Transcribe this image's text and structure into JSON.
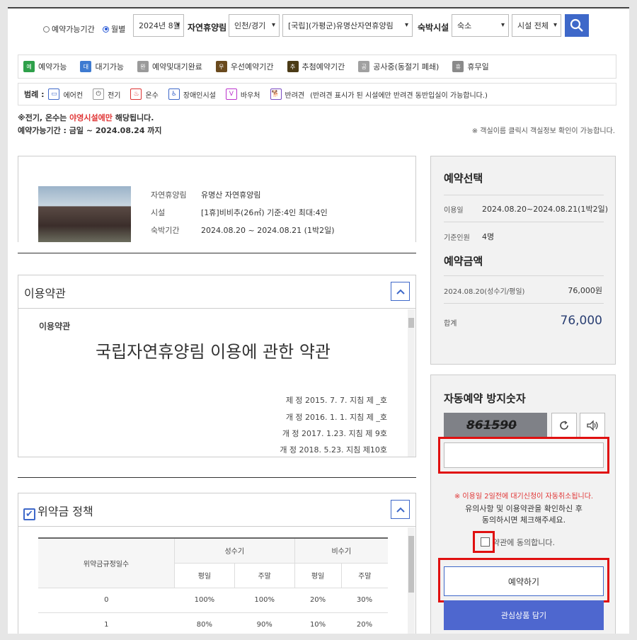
{
  "search": {
    "radio_period": "예약가능기간",
    "radio_month": "월별",
    "month": "2024년 8월",
    "label_forest": "자연휴양림",
    "region": "인천/경기",
    "forest": "[국립](가평군)유명산자연휴양림",
    "label_facility": "숙박시설",
    "facility_type": "숙소",
    "facility_all": "시설 전체"
  },
  "status_legend": [
    {
      "badge": "예",
      "label": "예약가능",
      "color": "#2ea04a"
    },
    {
      "badge": "대",
      "label": "대기가능",
      "color": "#3e7bd1"
    },
    {
      "badge": "완",
      "label": "예약및대기완료",
      "color": "#9a9a9a"
    },
    {
      "badge": "우",
      "label": "우선예약기간",
      "color": "#6a4a1e"
    },
    {
      "badge": "추",
      "label": "추첨예약기간",
      "color": "#4b3b16"
    },
    {
      "badge": "공",
      "label": "공사중(동절기 폐쇄)",
      "color": "#a0a0a0"
    },
    {
      "badge": "휴",
      "label": "휴무일",
      "color": "#8a8a8a"
    }
  ],
  "amenity_legend": {
    "title": "범례 :",
    "items": [
      {
        "label": "에어컨",
        "icon": "aircon-icon"
      },
      {
        "label": "전기",
        "icon": "electric-icon"
      },
      {
        "label": "온수",
        "icon": "hotwater-icon"
      },
      {
        "label": "장애인시설",
        "icon": "accessible-icon"
      },
      {
        "label": "바우처",
        "icon": "voucher-icon"
      },
      {
        "label": "반려견",
        "icon": "pet-icon"
      }
    ],
    "pet_note": "(반려견 표시가 된 시설에만 반려견 동반입실이 가능합니다.)"
  },
  "notes": {
    "line1_a": "※전기, 온수는 ",
    "line1_b": "야영시설에만",
    "line1_c": " 해당됩니다.",
    "line2": "예약가능기간 : 금일 ~ 2024.08.24 까지",
    "line3": "※ 객실이름 클릭시 객실정보 확인이 가능합니다."
  },
  "info": {
    "k_forest": "자연휴양림",
    "v_forest": "유명산 자연휴양림",
    "k_facility": "시설",
    "v_facility": "[1휴]비비추(26㎡) 기준:4인 최대:4인",
    "k_period": "숙박기간",
    "v_period": "2024.08.20 ~ 2024.08.21 (1박2일)"
  },
  "terms": {
    "panel_title": "이용약관",
    "small": "이용약관",
    "big": "국립자연휴양림 이용에 관한 약관",
    "lines": [
      "제 정 2015. 7. 7. 지침 제 _호",
      "개 정 2016. 1. 1. 지침 제 _호",
      "개 정 2017. 1.23. 지침 제 9호",
      "개 정 2018. 5.23. 지침 제10호"
    ]
  },
  "penalty": {
    "panel_title": "위약금 정책",
    "col_days": "위약금규정일수",
    "col_peak": "성수기",
    "col_off": "비수기",
    "weekday": "평일",
    "weekend": "주말",
    "rows": [
      {
        "days": "0",
        "p_wd": "100%",
        "p_we": "100%",
        "o_wd": "20%",
        "o_we": "30%"
      },
      {
        "days": "1",
        "p_wd": "80%",
        "p_we": "90%",
        "o_wd": "10%",
        "o_we": "20%"
      }
    ]
  },
  "reservation": {
    "title": "예약선택",
    "k_date": "이용일",
    "v_date": "2024.08.20~2024.08.21(1박2일)",
    "k_people": "기준인원",
    "v_people": "4명",
    "amount_title": "예약금액",
    "k_line": "2024.08.20(성수기/평일)",
    "v_line": "76,000원",
    "k_total": "합계",
    "v_total": "76,000"
  },
  "captcha": {
    "title": "자동예약 방지숫자",
    "code": "861590",
    "warn": "※ 이용일 2일전에 대기신청이 자동취소됩니다.",
    "agree1": "유의사항 및 이용약관을 확인하신 후",
    "agree2": "동의하시면 체크해주세요.",
    "chk_label": "약관에 동의합니다.",
    "reserve": "예약하기",
    "wish": "관심상품 담기"
  }
}
